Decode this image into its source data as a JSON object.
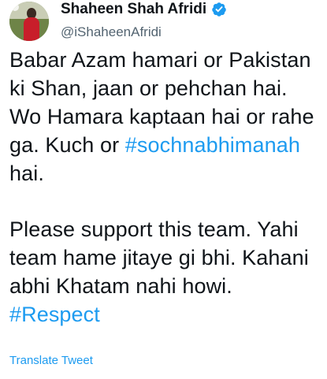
{
  "tweet": {
    "author": {
      "display_name": "Shaheen Shah Afridi",
      "handle": "@iShaheenAfridi",
      "verified_icon": "verified-badge-icon",
      "verified_color": "#1d9bf0"
    },
    "paragraph1": {
      "text_before": "Babar Azam hamari or Pakistan ki Shan, jaan or pehchan hai. Wo Hamara kaptaan hai or rahe ga. Kuch or ",
      "hashtag": "#sochnabhimanah",
      "text_after": " hai."
    },
    "paragraph2": {
      "text_before": "Please support this team. Yahi team hame jitaye gi bhi. Kahani abhi Khatam nahi howi. ",
      "hashtag": "#Respect"
    },
    "translate_label": "Translate Tweet",
    "colors": {
      "link": "#1d9bf0",
      "text": "#0f1419",
      "secondary": "#536471"
    }
  }
}
